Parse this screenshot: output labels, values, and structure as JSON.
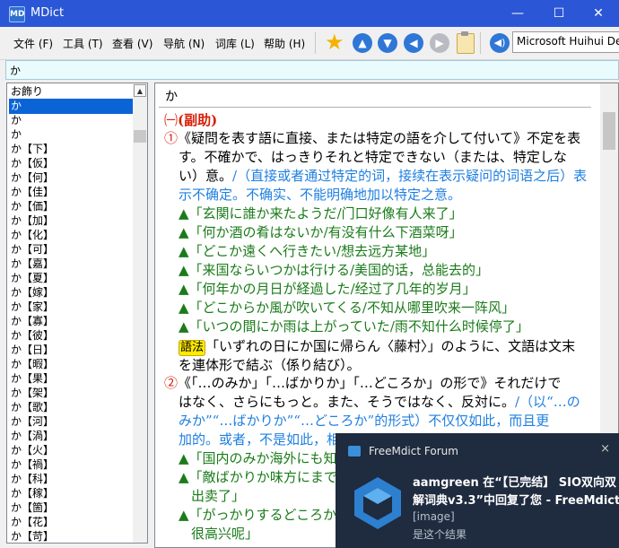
{
  "window": {
    "title": "MDict",
    "app_icon": "MD"
  },
  "menu": [
    "文件 (F)",
    "工具 (T)",
    "查看 (V)",
    "导航 (N)",
    "词库 (L)",
    "帮助 (H)"
  ],
  "toolbar": {
    "icons": [
      "star-icon",
      "arrow-up-icon",
      "arrow-down-icon",
      "arrow-back-icon",
      "arrow-forward-icon",
      "clipboard-icon",
      "speaker-icon"
    ],
    "font": "Microsoft Huihui Desktop"
  },
  "search": {
    "value": "か"
  },
  "wordlist": {
    "items": [
      "お飾り",
      "か",
      "か",
      "か",
      "か【下】",
      "か【仮】",
      "か【何】",
      "か【佳】",
      "か【価】",
      "か【加】",
      "か【化】",
      "か【可】",
      "か【嘉】",
      "か【夏】",
      "か【嫁】",
      "か【家】",
      "か【寡】",
      "か【彼】",
      "か【日】",
      "か【暇】",
      "か【果】",
      "か【架】",
      "か【歌】",
      "か【河】",
      "か【渦】",
      "か【火】",
      "か【禍】",
      "か【科】",
      "か【稼】",
      "か【箇】",
      "か【花】",
      "か【苛】"
    ],
    "selected_index": 1
  },
  "entry": {
    "headword": "か",
    "pos_num": "㈠",
    "pos": "(副助)",
    "sense1_num": "①",
    "sense1_jp_1": "《疑問を表す語に直接、または特定の語を介して付いて》不定を表",
    "sense1_jp_2": "す。不確かで、はっきりそれと特定できない（または、特定しな",
    "sense1_jp_3": "い）意。",
    "sense1_cn_a": "/（直接或者通过特定的词，接续在表示疑问的词语之后）表",
    "sense1_cn_b": "示不确定。不确实、不能明确地加以特定之意。",
    "ex_marker": "▲",
    "examples1": [
      {
        "jp": "「玄関に誰か来たようだ",
        "cn": "/门口好像有人来了」"
      },
      {
        "jp": "「何か酒の肴はないか",
        "cn": "/有没有什么下酒菜呀」"
      },
      {
        "jp": "「どこか遠くへ行きたい",
        "cn": "/想去远方某地」"
      },
      {
        "jp": "「来国ならいつかは行ける",
        "cn": "/美国的话，总能去的」"
      },
      {
        "jp": "「何年かの月日が経過した",
        "cn": "/经过了几年的岁月」"
      },
      {
        "jp": "「どこからか風が吹いてくる",
        "cn": "/不知从哪里吹来一阵风」"
      },
      {
        "jp": "「いつの間にか雨は上がっていた",
        "cn": "/雨不知什么时候停了」"
      }
    ],
    "grammar_tag": "語法",
    "grammar_1": "「いずれの日にか国に帰らん〈藤村〉」のように、文語は文末",
    "grammar_2": "を連体形で結ぶ（係り結び）。",
    "sense2_num": "②",
    "sense2_jp_1": "《「…のみか」「…ばかりか」「…どころか」の形で》それだけで",
    "sense2_jp_2": "はなく、さらにもっと。また、そうではなく、反対に。",
    "sense2_cn_a": "/（以“…の",
    "sense2_cn_b": "みか”“…ばかりか”“…どころか”的形式）不仅仅如此，而且更",
    "sense2_cn_c": "加的。或者，不是如此，相",
    "examples2": [
      {
        "jp": "「国内のみか海外にも知",
        "cn": ""
      },
      {
        "jp": "「敵ばかりか味方にまで",
        "cn": ""
      },
      {
        "jp": "",
        "cn": "出卖了」"
      },
      {
        "jp": "「がっかりするどころか",
        "cn": ""
      },
      {
        "jp": "",
        "cn": "很高兴呢」"
      }
    ]
  },
  "notification": {
    "source": "FreeMdict Forum",
    "line1": "aamgreen 在“【已完结】 SIO双向双",
    "line2": "解词典v3.3”中回复了您 - FreeMdict",
    "line3": "[image]",
    "line4": "是这个结果",
    "close": "×"
  }
}
